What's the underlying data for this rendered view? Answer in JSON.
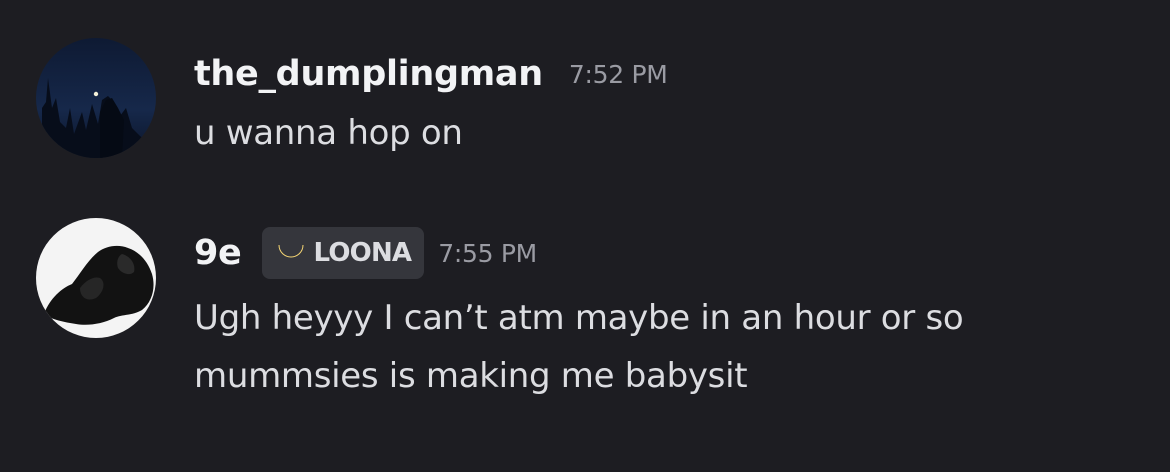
{
  "messages": [
    {
      "username": "the_dumplingman",
      "timestamp": "7:52 PM",
      "avatar": "night-trees-avatar",
      "lines": [
        "u wanna hop on"
      ]
    },
    {
      "username": "9e",
      "role": {
        "label": "LOONA",
        "icon": "crescent-moon-icon",
        "icon_color": "#e8b83a"
      },
      "timestamp": "7:55 PM",
      "avatar": "bw-photo-avatar",
      "lines": [
        "Ugh heyyy I can’t atm maybe in an hour or so",
        "mummsies is making me babysit"
      ]
    }
  ],
  "colors": {
    "background": "#1d1d22",
    "username": "#f2f3f5",
    "timestamp": "#9a9ba3",
    "text": "#dcdde1",
    "role_tag_bg": "#35363c"
  }
}
